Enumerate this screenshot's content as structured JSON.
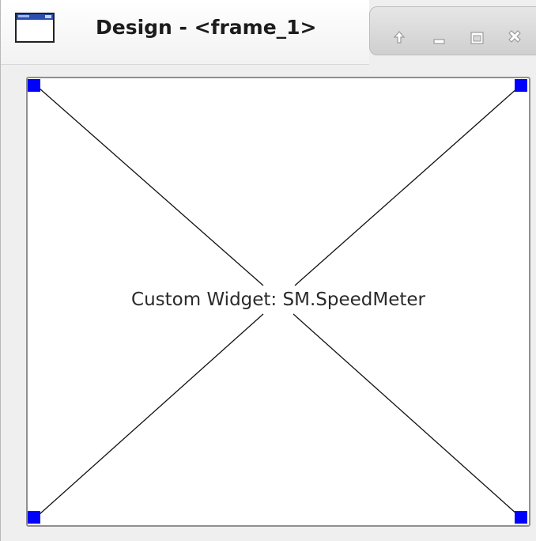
{
  "window": {
    "title": "Design - <frame_1>",
    "app_icon": "window-icon",
    "controls": [
      {
        "name": "shade-button",
        "icon": "arrow-up-icon"
      },
      {
        "name": "minimize-button",
        "icon": "minimize-icon"
      },
      {
        "name": "maximize-button",
        "icon": "maximize-icon"
      },
      {
        "name": "close-button",
        "icon": "close-icon"
      }
    ]
  },
  "canvas": {
    "widget_label": "Custom Widget: SM.SpeedMeter"
  },
  "colors": {
    "selection_handle": "#0000ff",
    "canvas_background": "#ffffff",
    "window_background": "#efefef"
  }
}
